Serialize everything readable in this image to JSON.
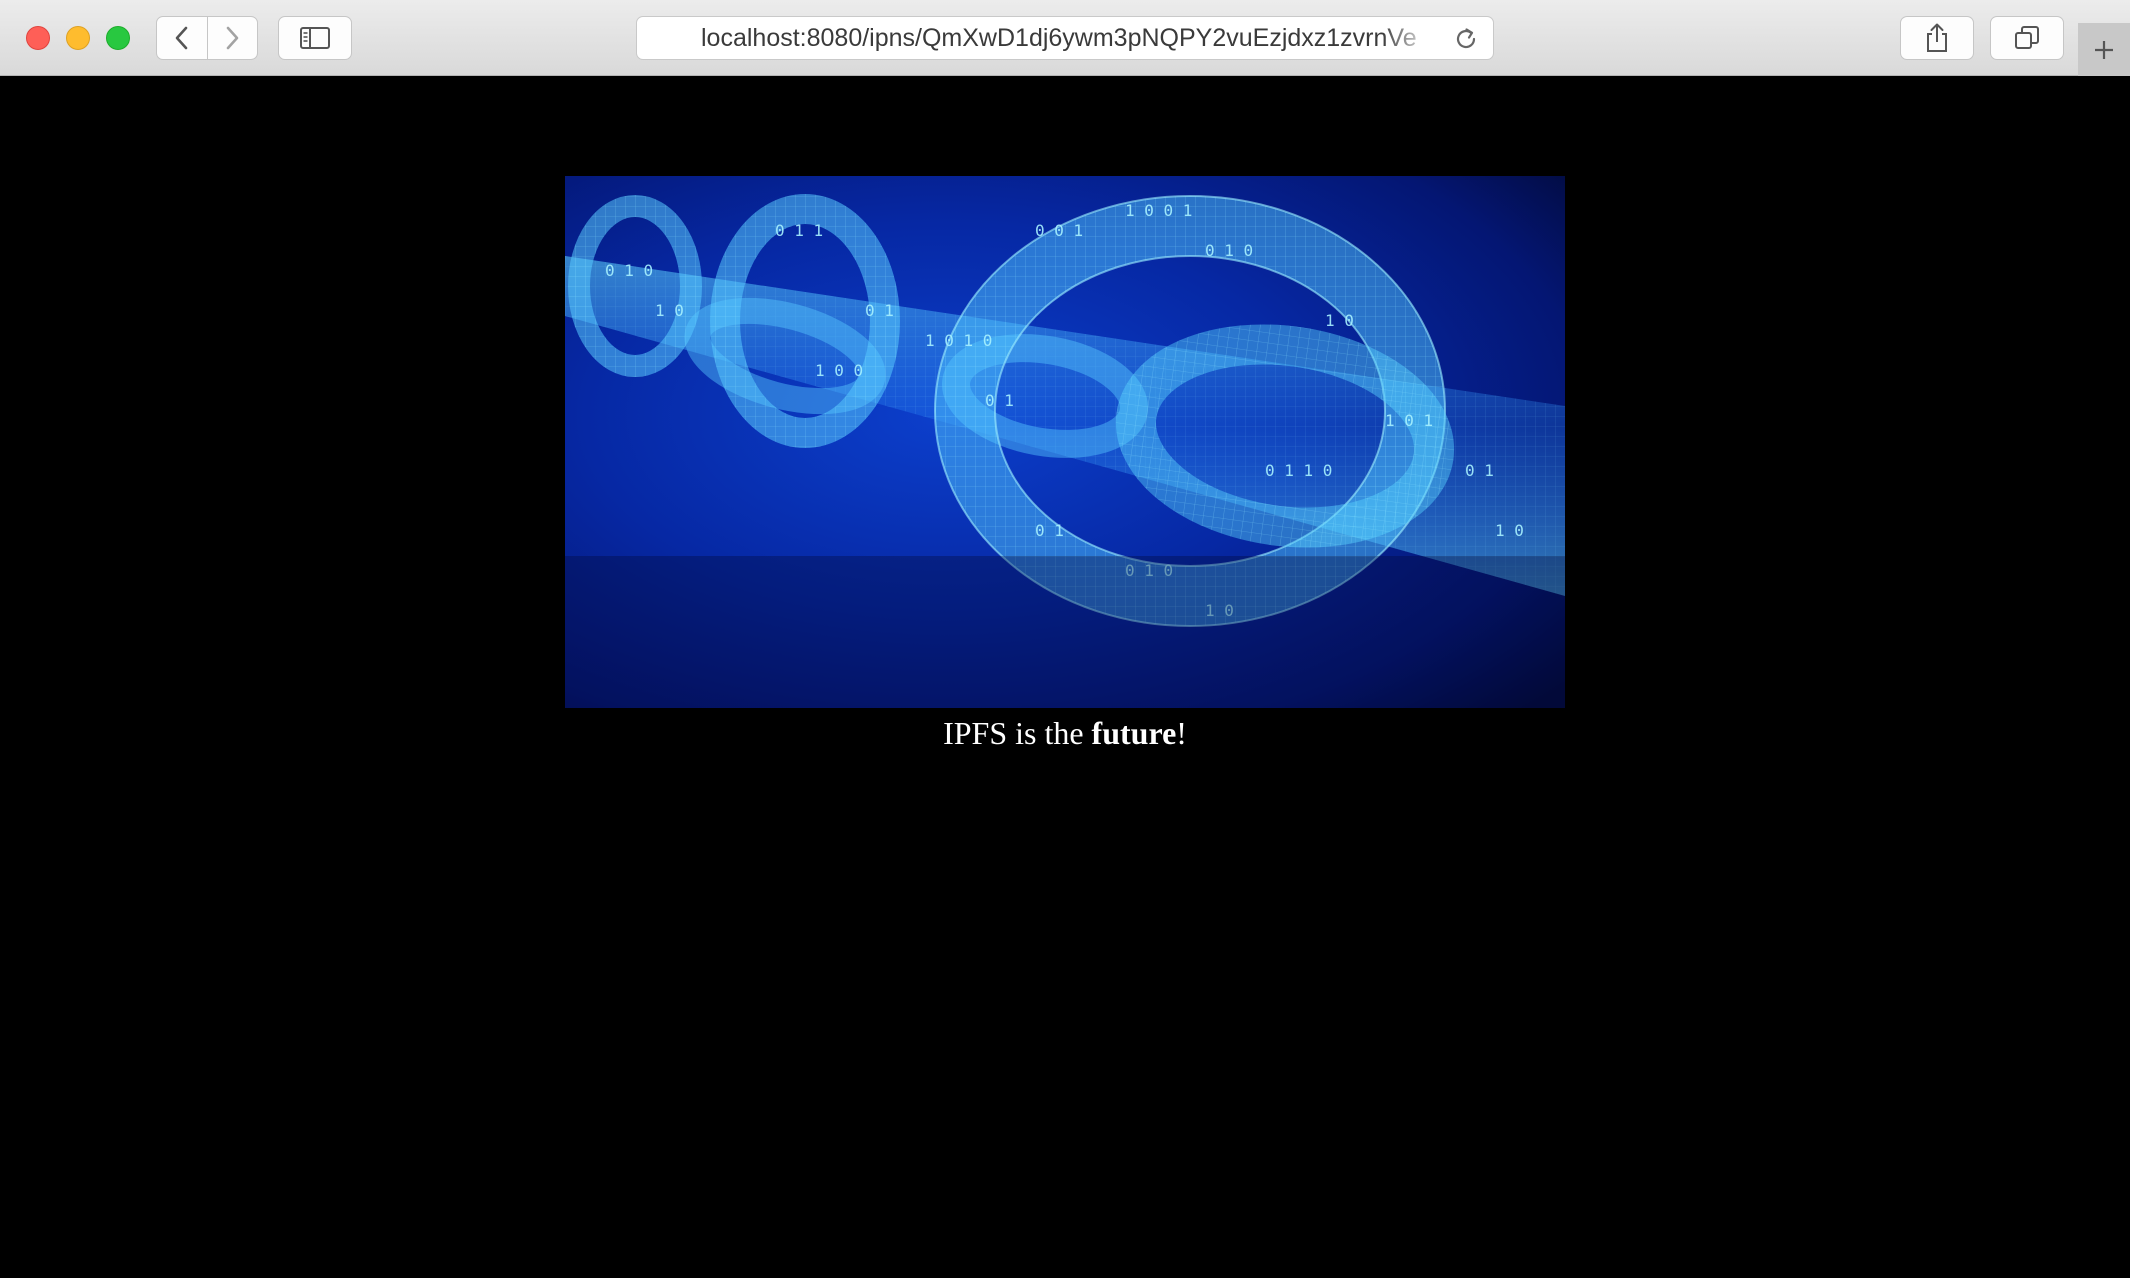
{
  "browser": {
    "url": "localhost:8080/ipns/QmXwD1dj6ywm3pNQPY2vuEzjdxz1zvrnVe",
    "icons": {
      "back": "chevron-left-icon",
      "forward": "chevron-right-icon",
      "sidebar": "sidebar-icon",
      "reload": "reload-icon",
      "share": "share-icon",
      "tabs": "tabs-overview-icon",
      "new_tab": "plus-icon"
    }
  },
  "page": {
    "image_description": "blue wireframe chain links with binary digits",
    "caption_prefix": "IPFS is the ",
    "caption_bold": "future",
    "caption_suffix": "!"
  },
  "colors": {
    "page_background": "#000000",
    "caption_text": "#ffffff",
    "image_primary": "#0a3cc0",
    "image_glow": "#4fd6ff"
  }
}
